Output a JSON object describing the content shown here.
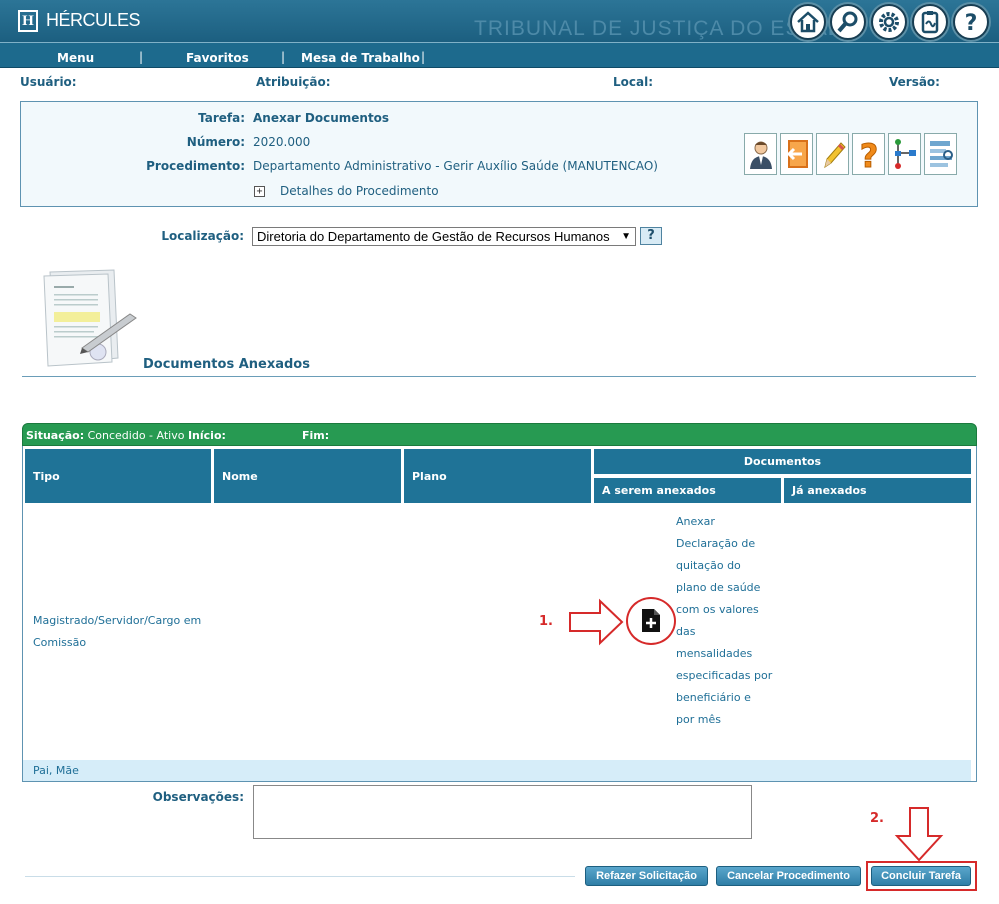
{
  "header": {
    "app_name": "HÉRCULES",
    "court_name": "TRIBUNAL DE JUSTIÇA DO ESTADO",
    "icons": [
      "home-icon",
      "search-icon",
      "gear-icon",
      "clipboard-icon",
      "help-icon"
    ]
  },
  "menu": {
    "items": [
      "Menu",
      "Favoritos",
      "Mesa de Trabalho"
    ],
    "separator": "|"
  },
  "user_info": {
    "user_label": "Usuário:",
    "role_label": "Atribuição:",
    "local_label": "Local:",
    "version_label": "Versão:"
  },
  "task": {
    "task_label": "Tarefa:",
    "task_value": "Anexar Documentos",
    "number_label": "Número:",
    "number_value": "2020.000",
    "procedure_label": "Procedimento:",
    "procedure_value": "Departamento Administrativo - Gerir Auxílio Saúde (MANUTENCAO)",
    "details_toggle": "+",
    "details_label": "Detalhes do Procedimento",
    "tool_icons": [
      "person-icon",
      "exit-icon",
      "pencil-icon",
      "question-icon",
      "flowchart-icon",
      "list-icon"
    ]
  },
  "location": {
    "label": "Localização:",
    "selected": "Diretoria do Departamento de Gestão de Recursos Humanos",
    "help": "?"
  },
  "documents": {
    "title": "Documentos Anexados"
  },
  "status": {
    "situacao_label": "Situação:",
    "situacao_value": "Concedido - Ativo",
    "inicio_label": "Início:",
    "fim_label": "Fim:"
  },
  "table": {
    "headers": {
      "tipo": "Tipo",
      "nome": "Nome",
      "plano": "Plano",
      "documentos": "Documentos",
      "a_serem": "A serem anexados",
      "ja_anexados": "Já anexados"
    },
    "row": {
      "tipo_line1": "Magistrado/Servidor/Cargo em",
      "tipo_line2": "Comissão",
      "doc_lines": [
        "Anexar",
        "Declaração de",
        "quitação do",
        "plano de saúde",
        "com os valores",
        "das",
        "mensalidades",
        "especificadas por",
        "beneficiário e",
        "por mês"
      ]
    },
    "footer": "Pai, Mãe"
  },
  "annotations": {
    "step1": "1.",
    "step2": "2.",
    "color": "#d62a2a"
  },
  "observations": {
    "label": "Observações:",
    "value": ""
  },
  "buttons": {
    "redo": "Refazer Solicitação",
    "cancel": "Cancelar Procedimento",
    "conclude": "Concluir Tarefa"
  },
  "colors": {
    "header": "#1d6a8d",
    "status_green": "#279a52",
    "table_header": "#1f7397",
    "text": "#1f5f80"
  }
}
